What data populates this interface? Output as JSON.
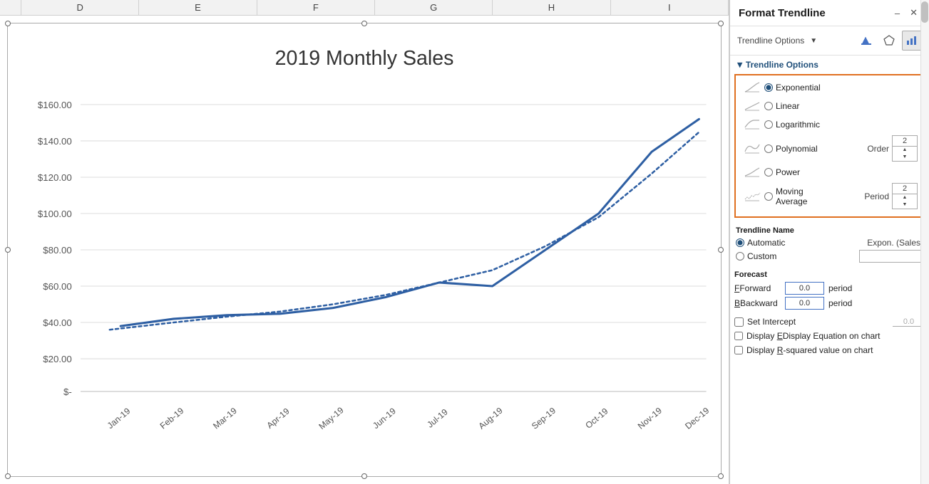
{
  "columns": [
    "D",
    "E",
    "F",
    "G",
    "H",
    "I"
  ],
  "chart": {
    "title": "2019 Monthly Sales",
    "y_labels": [
      "$160.00",
      "$140.00",
      "$120.00",
      "$100.00",
      "$80.00",
      "$60.00",
      "$40.00",
      "$20.00",
      "$-"
    ],
    "x_labels": [
      "Jan-19",
      "Feb-19",
      "Mar-19",
      "Apr-19",
      "May-19",
      "Jun-19",
      "Jul-19",
      "Aug-19",
      "Sep-19",
      "Oct-19",
      "Nov-19",
      "Dec-19"
    ]
  },
  "panel": {
    "title": "Format Trendline",
    "trendline_options_label": "Trendline Options",
    "options": [
      {
        "id": "exponential",
        "label": "Exponential",
        "checked": true
      },
      {
        "id": "linear",
        "label": "Linear",
        "checked": false
      },
      {
        "id": "logarithmic",
        "label": "Logarithmic",
        "checked": false
      },
      {
        "id": "polynomial",
        "label": "Polynomial",
        "checked": false
      },
      {
        "id": "power",
        "label": "Power",
        "checked": false
      },
      {
        "id": "moving_average",
        "label": "Moving Average",
        "checked": false
      }
    ],
    "polynomial_order_label": "Order",
    "polynomial_order_value": "2",
    "moving_avg_period_label": "Period",
    "moving_avg_period_value": "2",
    "trendline_name_label": "Trendline Name",
    "name_automatic_label": "Automatic",
    "name_automatic_value": "Expon. (Sales)",
    "name_custom_label": "Custom",
    "forecast_label": "Forecast",
    "forward_label": "Forward",
    "forward_value": "0.0",
    "forward_period": "period",
    "backward_label": "Backward",
    "backward_value": "0.0",
    "backward_period": "period",
    "set_intercept_label": "Set Intercept",
    "set_intercept_value": "0.0",
    "display_equation_label": "Display Equation on chart",
    "display_rsquared_label": "Display R-squared value on chart"
  }
}
